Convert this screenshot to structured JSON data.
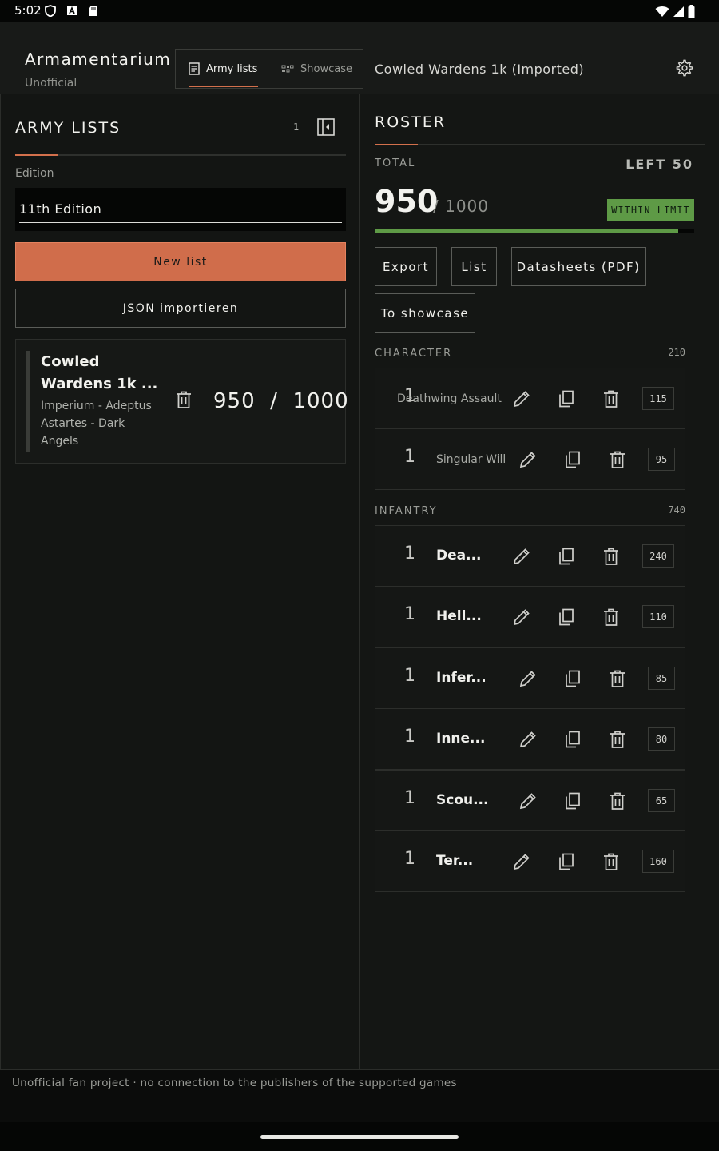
{
  "status": {
    "time": "5:02"
  },
  "app": {
    "title": "Armamentarium",
    "subtitle": "Unofficial",
    "tabs": [
      {
        "label": "Army lists",
        "active": true
      },
      {
        "label": "Showcase",
        "active": false
      }
    ],
    "current_list": "Cowled Wardens 1k (Imported)"
  },
  "army_lists": {
    "heading": "ARMY LISTS",
    "count": "1",
    "edition_label": "Edition",
    "edition_value": "11th Edition",
    "new_list_label": "New list",
    "import_label": "JSON importieren",
    "lists": [
      {
        "name": "Cowled Wardens 1k ...",
        "faction": "Imperium - Adeptus Astartes - Dark Angels",
        "points": "950  /  1000"
      }
    ]
  },
  "roster": {
    "heading": "ROSTER",
    "total_label": "TOTAL",
    "left_label": "LEFT 50",
    "total_points": "950",
    "max_points": "/ 1000",
    "limit_status": "WITHIN LIMIT",
    "progress": 0.95,
    "actions": [
      "Export",
      "List",
      "Datasheets (PDF)",
      "To showcase"
    ],
    "sections": [
      {
        "title": "CHARACTER",
        "points": "210",
        "units": [
          {
            "qty": "1",
            "name": "Deathwing Assault",
            "points": "115"
          },
          {
            "qty": "1",
            "name": "Singular Will",
            "points": "95"
          }
        ]
      },
      {
        "title": "INFANTRY",
        "points": "740",
        "units": [
          {
            "qty": "1",
            "name": "Dea...",
            "points": "240"
          },
          {
            "qty": "1",
            "name": "Hell...",
            "points": "110"
          },
          {
            "qty": "1",
            "name": "Infer...",
            "points": "85"
          },
          {
            "qty": "1",
            "name": "Inne...",
            "points": "80"
          },
          {
            "qty": "1",
            "name": "Scou...",
            "points": "65"
          },
          {
            "qty": "1",
            "name": "Ter...",
            "points": "160"
          }
        ]
      }
    ]
  },
  "footer": {
    "text": "Unofficial fan project · no connection to the publishers of the supported games"
  },
  "colors": {
    "accent": "#d06d4b",
    "success": "#5e9a46",
    "background": "#151715"
  }
}
